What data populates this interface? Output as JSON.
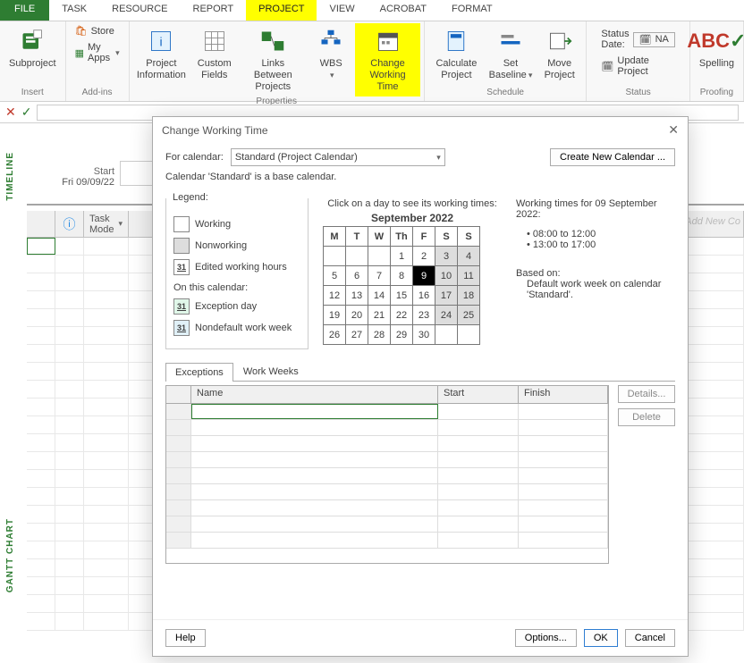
{
  "tabs": {
    "file": "FILE",
    "task": "TASK",
    "resource": "RESOURCE",
    "report": "REPORT",
    "project": "PROJECT",
    "view": "VIEW",
    "acrobat": "ACROBAT",
    "format": "FORMAT"
  },
  "ribbon": {
    "insert": {
      "subproject": "Subproject",
      "label": "Insert"
    },
    "addins": {
      "store": "Store",
      "myapps": "My Apps",
      "label": "Add-ins"
    },
    "properties": {
      "projectinfo": "Project Information",
      "customfields": "Custom Fields",
      "links": "Links Between Projects",
      "wbs": "WBS",
      "cwt": "Change Working Time",
      "label": "Properties"
    },
    "schedule": {
      "calc": "Calculate Project",
      "baseline": "Set Baseline",
      "move": "Move Project",
      "label": "Schedule"
    },
    "status": {
      "statusdate": "Status Date:",
      "statusval": "NA",
      "update": "Update Project",
      "label": "Status"
    },
    "proofing": {
      "spelling": "Spelling",
      "label": "Proofing"
    }
  },
  "sidelabels": {
    "timeline": "TIMELINE",
    "gantt": "GANTT CHART"
  },
  "timeline": {
    "startlbl": "Start",
    "startdate": "Fri 09/09/22"
  },
  "grid": {
    "taskmode": "Task Mode",
    "addnew": "Add New Co"
  },
  "dialog": {
    "title": "Change Working Time",
    "forcal": "For calendar:",
    "selected": "Standard (Project Calendar)",
    "createnew": "Create New Calendar ...",
    "basecal": "Calendar 'Standard' is a base calendar.",
    "legend": "Legend:",
    "lg_working": "Working",
    "lg_nonworking": "Nonworking",
    "lg_edited": "Edited working hours",
    "onthis": "On this calendar:",
    "lg_exc": "Exception day",
    "lg_ndw": "Nondefault work week",
    "lg31": "31",
    "clickday": "Click on a day to see its working times:",
    "month": "September 2022",
    "dow": [
      "M",
      "T",
      "W",
      "Th",
      "F",
      "S",
      "S"
    ],
    "wt_head": "Working times for 09 September 2022:",
    "wt1": "08:00 to 12:00",
    "wt2": "13:00 to 17:00",
    "based": "Based on:",
    "based2": "Default work week on calendar 'Standard'.",
    "tab_exc": "Exceptions",
    "tab_ww": "Work Weeks",
    "th_name": "Name",
    "th_start": "Start",
    "th_finish": "Finish",
    "details": "Details...",
    "delete": "Delete",
    "help": "Help",
    "options": "Options...",
    "ok": "OK",
    "cancel": "Cancel"
  }
}
